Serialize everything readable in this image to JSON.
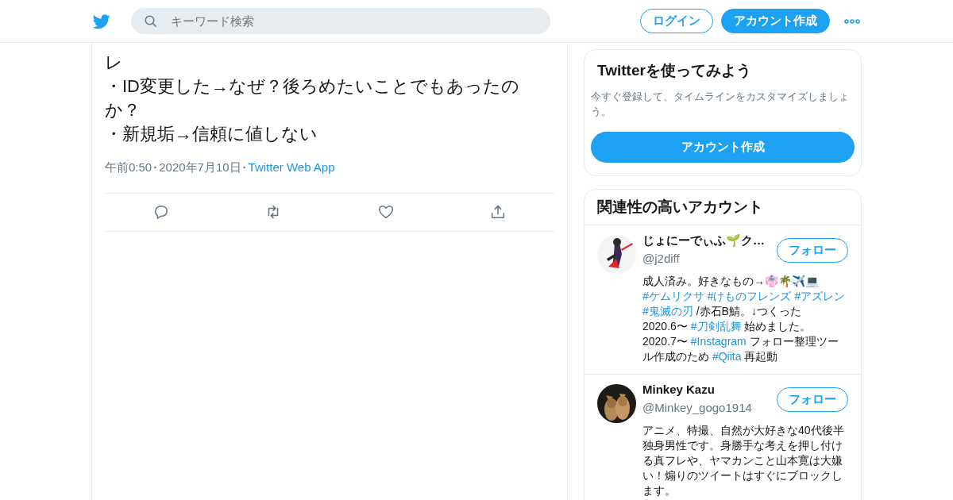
{
  "header": {
    "search": {
      "placeholder": "キーワード検索"
    },
    "login_button": "ログイン",
    "signup_button": "アカウント作成"
  },
  "tweet": {
    "lines": [
      "レ",
      "・ID変更した→なぜ？後ろめたいことでもあったのか？",
      "・新規垢→信頼に値しない"
    ],
    "meta": [
      {
        "kind": "text",
        "text": "午前0:50"
      },
      {
        "kind": "separator",
        "text": "·"
      },
      {
        "kind": "text",
        "text": "2020年7月10日"
      },
      {
        "kind": "separator",
        "text": "·"
      }
    ],
    "source": "Twitter Web App"
  },
  "signup_card": {
    "title": "Twitterを使ってみよう",
    "text": "今すぐ登録して、タイムラインをカスタマイズしましょう。",
    "button": "アカウント作成"
  },
  "related": {
    "title": "関連性の高いアカウント",
    "accounts": [
      {
        "name": "じょにーでぃふ🌱ク…",
        "handle": "@j2diff",
        "follow": "フォロー",
        "bio": [
          {
            "kind": "text",
            "text": "成人済み。好きなもの→👘🌴✈️💻"
          },
          {
            "kind": "hashtag",
            "text": "#ケムリクサ"
          },
          {
            "kind": "hashtag",
            "text": "#けものフレンズ"
          },
          {
            "kind": "hashtag",
            "text": "#アズレン"
          },
          {
            "kind": "hashtag",
            "text": "#鬼滅の刃"
          },
          {
            "kind": "text",
            "text": "/赤石B鯖。↓つくった 2020.6〜"
          },
          {
            "kind": "hashtag",
            "text": "#刀剣乱舞"
          },
          {
            "kind": "text",
            "text": "始めました。 2020.7〜"
          },
          {
            "kind": "hashtag",
            "text": "#Instagram"
          },
          {
            "kind": "text",
            "text": "フォロー整理ツール作成のため"
          },
          {
            "kind": "hashtag",
            "text": "#Qiita"
          },
          {
            "kind": "text",
            "text": "再起動"
          }
        ]
      },
      {
        "name": "Minkey Kazu",
        "handle": "@Minkey_gogo1914",
        "follow": "フォロー",
        "bio": [
          {
            "kind": "text",
            "text": "アニメ、特撮、自然が大好きな40代後半独身男性です。身勝手な考えを押し付ける真フレや、ヤマカンこと山本寛は大嫌い！煽りのツイートはすぐにブロックします。"
          }
        ]
      }
    ]
  }
}
